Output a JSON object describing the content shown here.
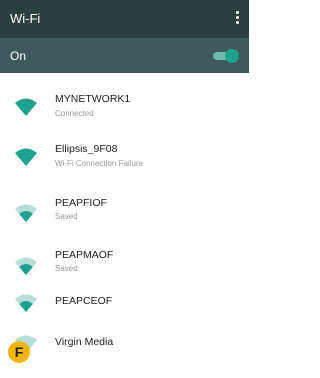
{
  "header": {
    "title": "Wi-Fi"
  },
  "wifi_toggle": {
    "label": "On",
    "state": "on"
  },
  "networks": [
    {
      "name": "MYNETWORK1",
      "status": "Connected",
      "signal": "full"
    },
    {
      "name": "Ellipsis_9F08",
      "status": "Wi-Fi Connection Failure",
      "signal": "full"
    },
    {
      "name": "PEAPFIOF",
      "status": "Saved",
      "signal": "medium"
    },
    {
      "name": "PEAPMAOF",
      "status": "Saved",
      "signal": "medium"
    },
    {
      "name": "PEAPCEOF",
      "status": "",
      "signal": "medium"
    },
    {
      "name": "Virgin Media",
      "status": "",
      "signal": "low"
    }
  ],
  "badge": {
    "letter": "F"
  },
  "colors": {
    "appbar": "#2b3f3f",
    "toggle_bar": "#3d5959",
    "accent": "#1ea290",
    "badge": "#f2b614"
  },
  "icons": {
    "overflow": "more-vert-icon",
    "wifi": "wifi-signal-icon"
  }
}
